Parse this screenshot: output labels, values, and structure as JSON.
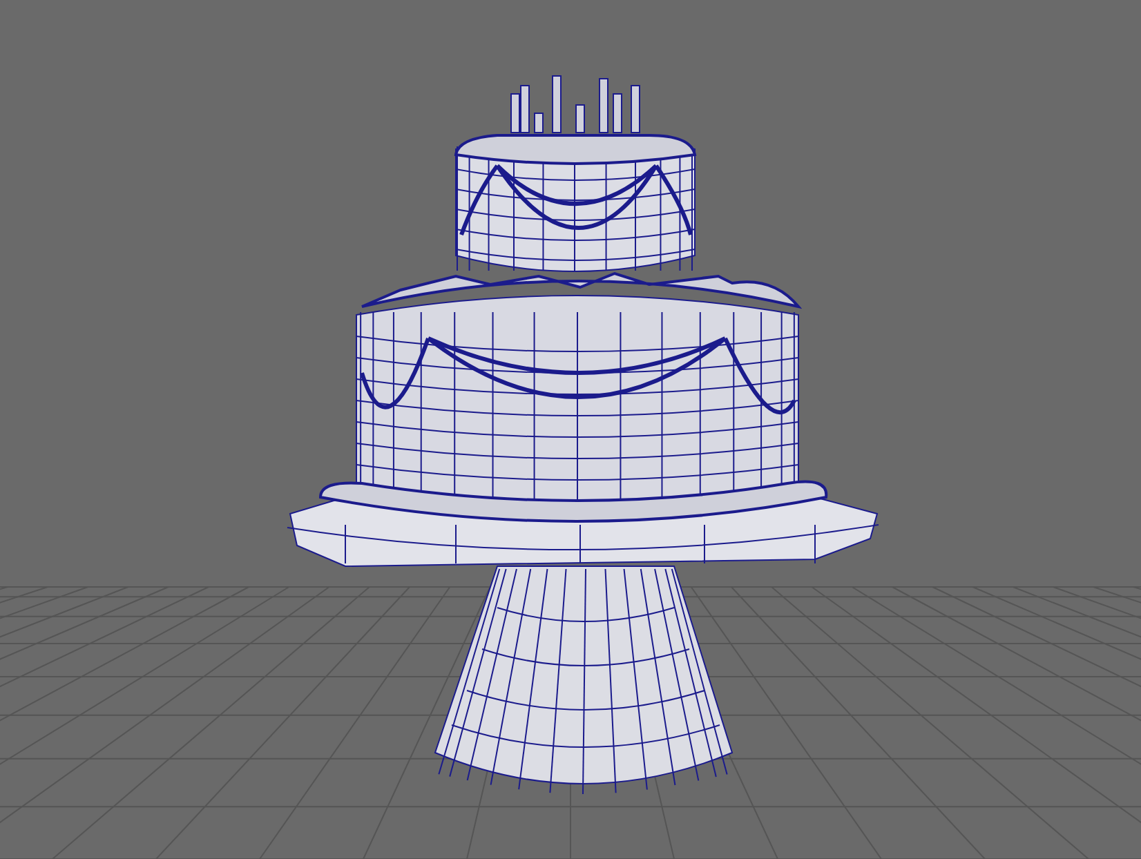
{
  "viewport": {
    "kind": "perspective",
    "wireframe": true
  }
}
